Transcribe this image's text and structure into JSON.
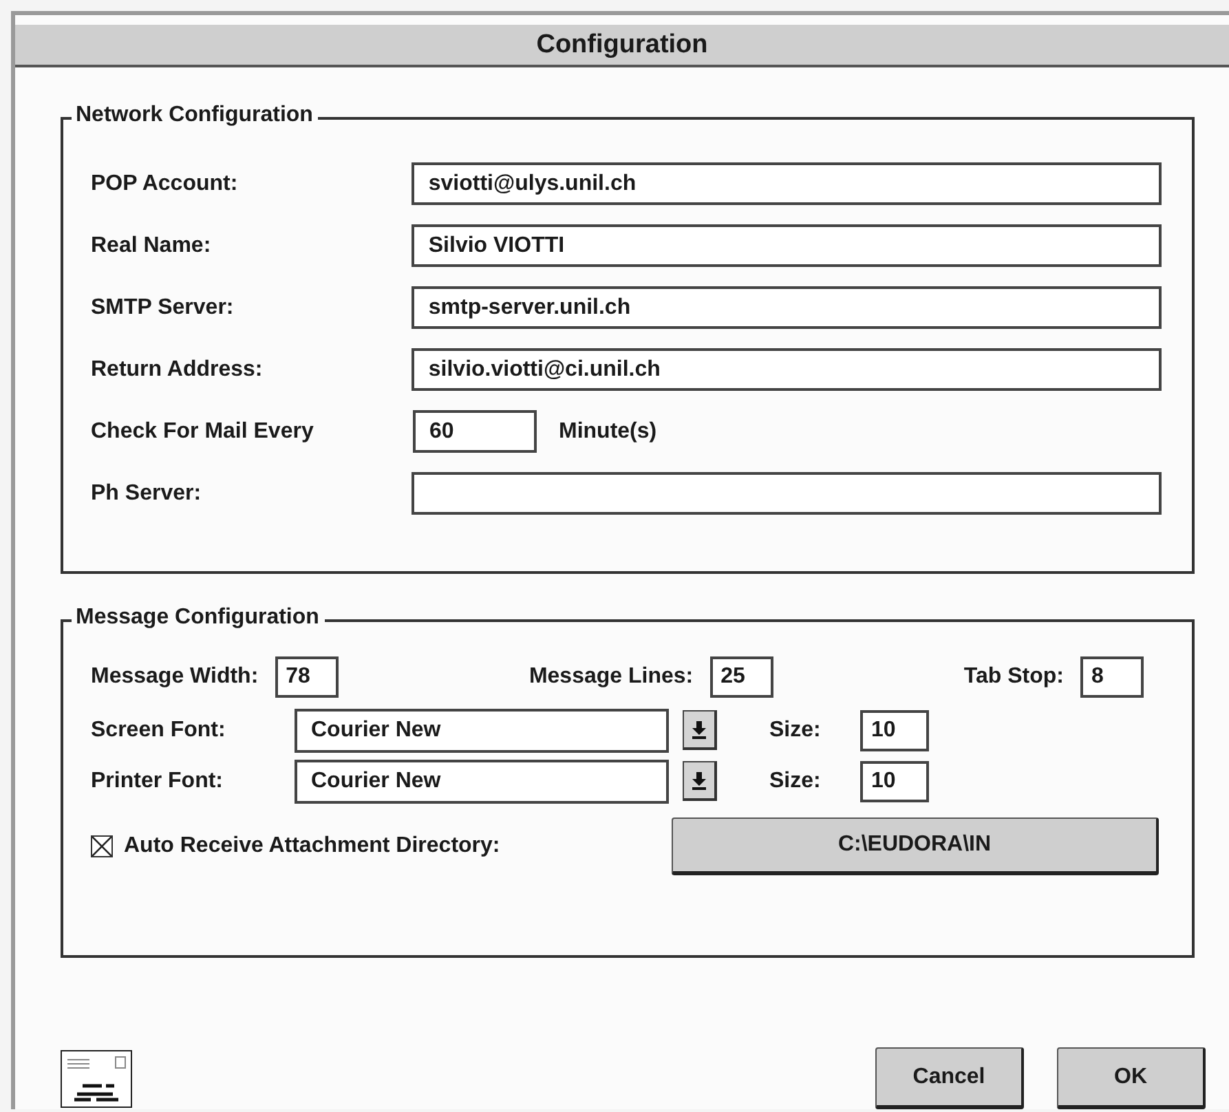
{
  "window": {
    "title": "Configuration"
  },
  "network_configuration": {
    "title": "Network Configuration",
    "fields": [
      {
        "kind": "text",
        "label": "POP Account:",
        "value": "sviotti@ulys.unil.ch"
      },
      {
        "kind": "text",
        "label": "Real Name:",
        "value": "Silvio VIOTTI"
      },
      {
        "kind": "text",
        "label": "SMTP Server:",
        "value": "smtp-server.unil.ch"
      },
      {
        "kind": "text",
        "label": "Return Address:",
        "value": "silvio.viotti@ci.unil.ch"
      },
      {
        "kind": "interval",
        "label": "Check For Mail Every",
        "value": "60",
        "unit": "Minute(s)"
      },
      {
        "kind": "text",
        "label": "Ph Server:"
      }
    ]
  },
  "message_configuration": {
    "title": "Message Configuration",
    "numbers": [
      {
        "label": "Message Width:",
        "value": "78"
      },
      {
        "label": "Message Lines:",
        "value": "25"
      },
      {
        "label": "Tab Stop:",
        "value": "8"
      }
    ],
    "fonts": [
      {
        "label": "Screen Font:",
        "value": "Courier New",
        "size_label": "Size:",
        "size": "10"
      },
      {
        "label": "Printer Font:",
        "value": "Courier New",
        "size_label": "Size:",
        "size": "10"
      }
    ],
    "attachments": {
      "label": "Auto Receive Attachment Directory:",
      "checked": true,
      "directory": "C:\\EUDORA\\IN"
    }
  },
  "buttons": [
    "Cancel",
    "OK"
  ]
}
